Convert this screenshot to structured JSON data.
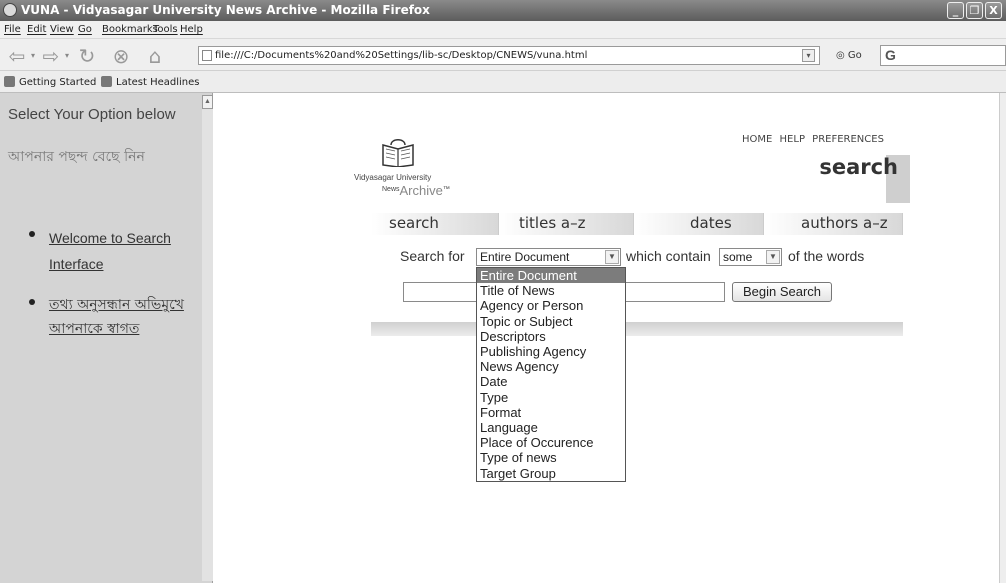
{
  "window": {
    "title": "VUNA - Vidyasagar University News Archive - Mozilla Firefox",
    "controls": [
      "_",
      "❐",
      "X"
    ]
  },
  "menu": [
    "File",
    "Edit",
    "View",
    "Go",
    "Bookmarks",
    "Tools",
    "Help"
  ],
  "navbar": {
    "url": "file:///C:/Documents%20and%20Settings/lib-sc/Desktop/CNEWS/vuna.html",
    "go_label": "Go",
    "search_placeholder": "G"
  },
  "bookmarks": [
    "Getting Started",
    "Latest Headlines"
  ],
  "left": {
    "heading": "Select Your Option below",
    "heading_bn": "আপনার পছন্দ বেছে নিন",
    "items": [
      {
        "label": "Welcome to Search Interface"
      },
      {
        "label": "তথ্য অনুসন্ধান অভিমুখে আপনাকে স্বাগত"
      }
    ]
  },
  "logo": {
    "line1": "Vidyasagar University",
    "news": "News",
    "archive": "Archive",
    "tm": "™"
  },
  "toplinks": [
    "HOME",
    "HELP",
    "PREFERENCES"
  ],
  "page_heading": "search",
  "tabs": [
    "search",
    "titles a–z",
    "dates",
    "authors a–z"
  ],
  "form": {
    "search_for": "Search for",
    "field_selected": "Entire Document",
    "which_contain": "which contain",
    "mode_selected": "some",
    "of_the_words": "of the words",
    "query_value": "",
    "button": "Begin Search"
  },
  "dropdown_options": [
    "Entire Document",
    "Title of News",
    "Agency or Person",
    "Topic or Subject",
    "Descriptors",
    "Publishing Agency",
    "News Agency",
    "Date",
    "Type",
    "Format",
    "Language",
    "Place of Occurence",
    "Type of news",
    "Target Group"
  ]
}
